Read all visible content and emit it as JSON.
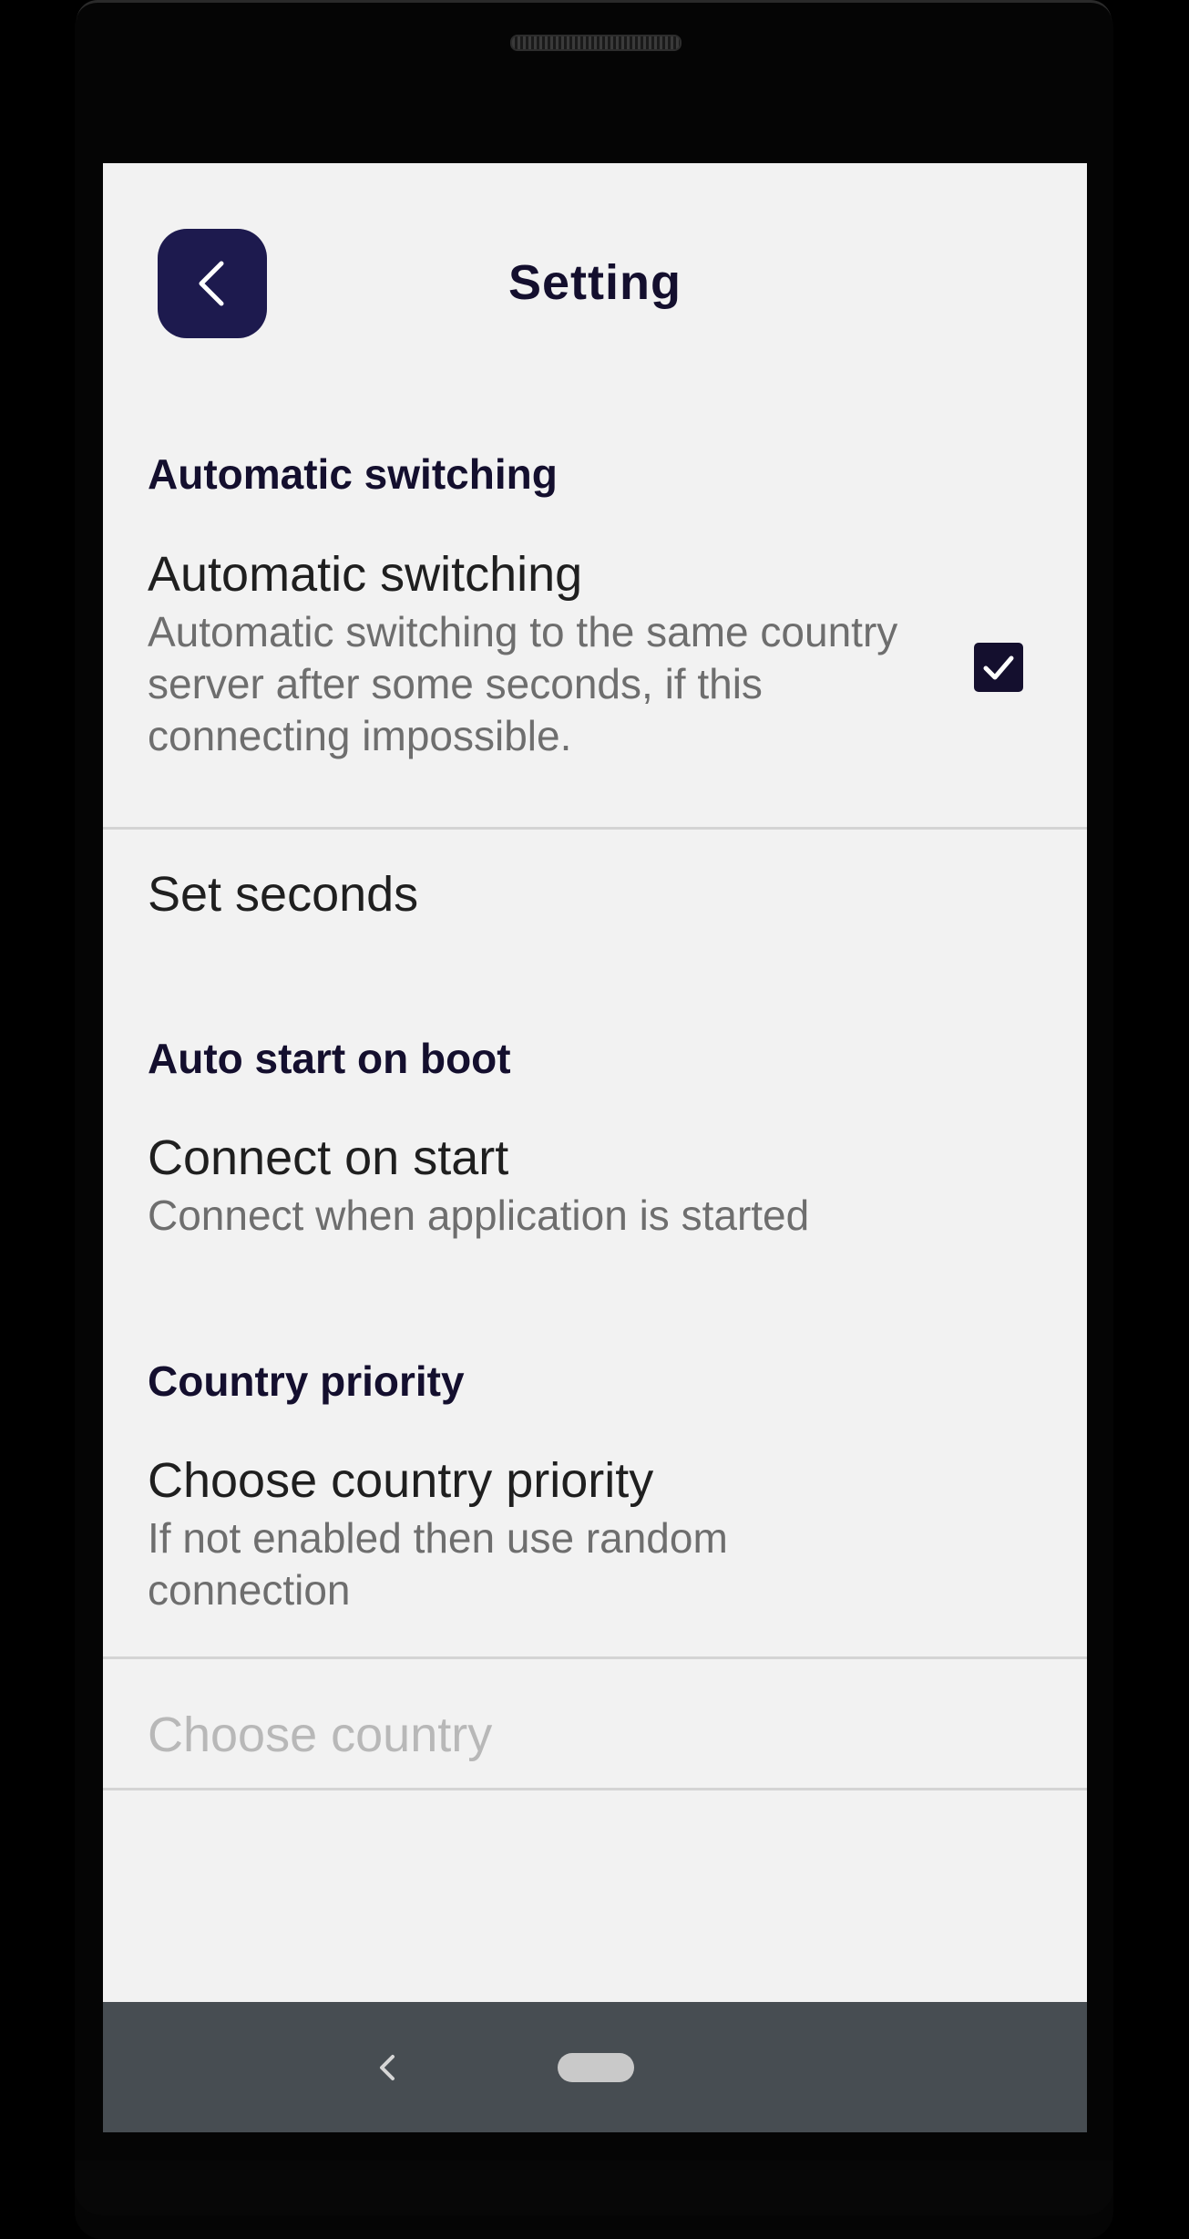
{
  "header": {
    "title": "Setting",
    "back_icon": "chevron-left-icon"
  },
  "sections": {
    "auto_switch": {
      "category": "Automatic switching",
      "title": "Automatic switching",
      "summary": "Automatic switching to the same country server after some seconds, if this connecting impossible.",
      "checked": true
    },
    "set_seconds": {
      "title": "Set seconds"
    },
    "auto_start": {
      "category": "Auto start on boot",
      "title": "Connect on start",
      "summary": "Connect when application is started"
    },
    "country_priority": {
      "category": "Country priority",
      "title": "Choose country priority",
      "summary": "If not enabled then use random connection"
    },
    "choose_country": {
      "title": "Choose country",
      "enabled": false
    }
  },
  "colors": {
    "accent": "#1d1a4e",
    "background": "#f2f2f2",
    "nav_bar": "#474d52"
  },
  "nav": {
    "back_icon": "nav-back-icon",
    "home_icon": "home-pill-icon"
  }
}
